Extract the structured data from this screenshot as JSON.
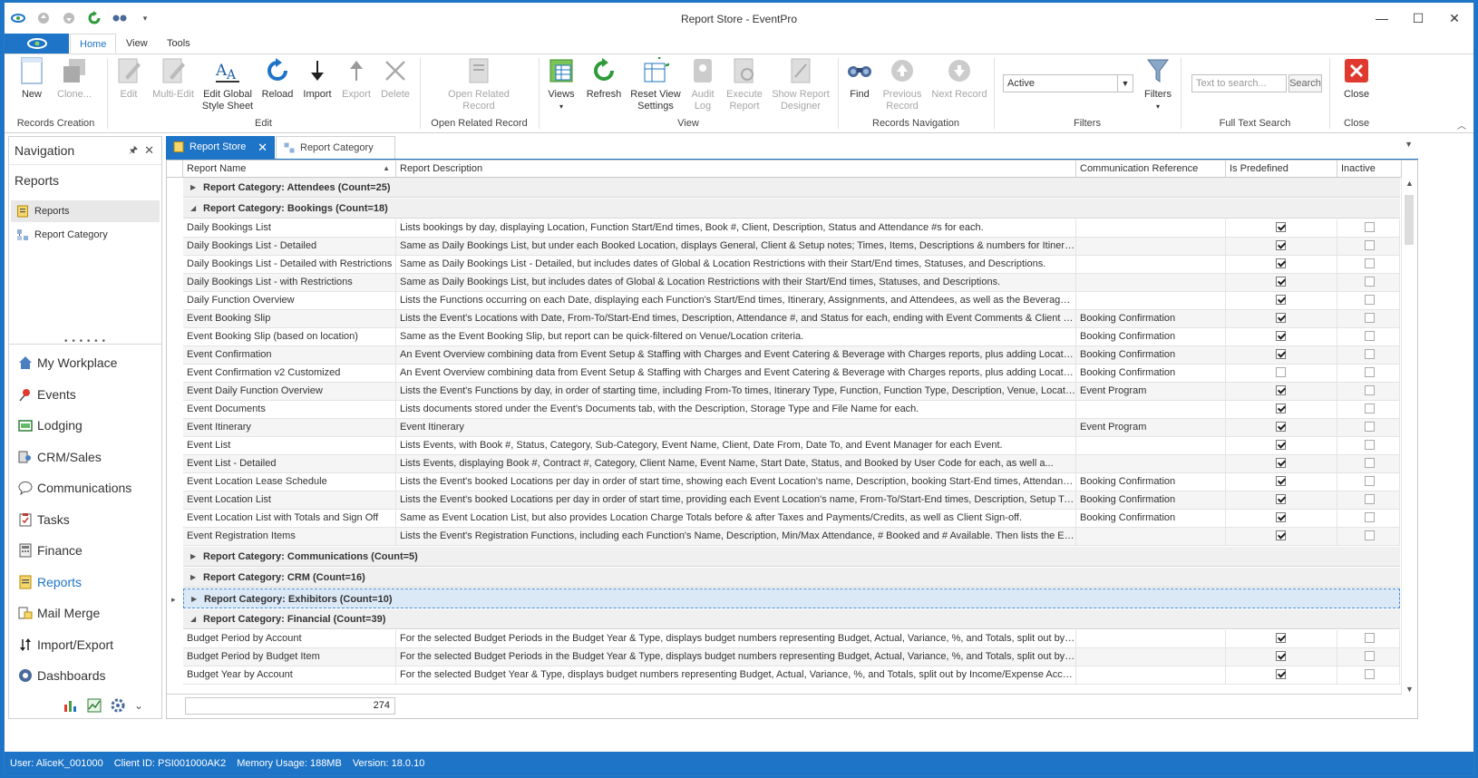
{
  "window": {
    "title": "Report Store - EventPro"
  },
  "ribbon_tabs": [
    "Home",
    "View",
    "Tools"
  ],
  "ribbon": {
    "new": "New",
    "clone": "Clone...",
    "edit": "Edit",
    "multi_edit": "Multi-Edit",
    "edit_global_1": "Edit Global",
    "edit_global_2": "Style Sheet",
    "reload": "Reload",
    "import": "Import",
    "export": "Export",
    "delete": "Delete",
    "open_related_1": "Open Related",
    "open_related_2": "Record",
    "views": "Views",
    "refresh": "Refresh",
    "reset_view_1": "Reset View",
    "reset_view_2": "Settings",
    "audit_1": "Audit",
    "audit_2": "Log",
    "execute_1": "Execute",
    "execute_2": "Report",
    "show_report_1": "Show Report",
    "show_report_2": "Designer",
    "find": "Find",
    "prev_1": "Previous",
    "prev_2": "Record",
    "next_1": "Next Record",
    "filter_value": "Active",
    "filters": "Filters",
    "search_placeholder": "Text to search...",
    "search_btn": "Search",
    "close": "Close",
    "groups": {
      "records_creation": "Records Creation",
      "edit": "Edit",
      "open_related_record": "Open Related Record",
      "view": "View",
      "records_navigation": "Records Navigation",
      "filters": "Filters",
      "full_text_search": "Full Text Search",
      "close": "Close"
    }
  },
  "nav": {
    "title": "Navigation",
    "section": "Reports",
    "items": [
      "Reports",
      "Report Category"
    ],
    "modules": [
      "My Workplace",
      "Events",
      "Lodging",
      "CRM/Sales",
      "Communications",
      "Tasks",
      "Finance",
      "Reports",
      "Mail Merge",
      "Import/Export",
      "Dashboards"
    ]
  },
  "doc_tabs": [
    "Report Store",
    "Report Category"
  ],
  "grid": {
    "columns": [
      "Report Name",
      "Report Description",
      "Communication Reference",
      "Is Predefined",
      "Inactive"
    ],
    "groups": {
      "attendees": "Report Category: Attendees (Count=25)",
      "bookings": "Report Category: Bookings (Count=18)",
      "communications": "Report Category: Communications (Count=5)",
      "crm": "Report Category: CRM (Count=16)",
      "exhibitors": "Report Category: Exhibitors (Count=10)",
      "financial": "Report Category: Financial (Count=39)"
    },
    "bookings_rows": [
      {
        "name": "Daily Bookings List",
        "desc": "Lists bookings by day, displaying Location, Function Start/End times, Book #, Client, Description, Status and Attendance #s for each.",
        "comm": "",
        "pre": true,
        "inactive": false
      },
      {
        "name": "Daily Bookings List - Detailed",
        "desc": "Same as Daily Bookings List, but under each Booked Location, displays General, Client & Setup notes; Times, Items, Descriptions & numbers for Itinerary, Cate...",
        "comm": "",
        "pre": true,
        "inactive": false
      },
      {
        "name": "Daily Bookings List - Detailed with Restrictions",
        "desc": "Same as Daily Bookings List - Detailed, but includes dates of Global & Location Restrictions with their Start/End times, Statuses, and Descriptions.",
        "comm": "",
        "pre": true,
        "inactive": false
      },
      {
        "name": "Daily Bookings List - with Restrictions",
        "desc": "Same as Daily Bookings List, but includes dates of Global & Location Restrictions with their Start/End times, Statuses, and Descriptions.",
        "comm": "",
        "pre": true,
        "inactive": false
      },
      {
        "name": "Daily Function Overview",
        "desc": "Lists the Functions occurring on each Date, displaying each Function's Start/End times, Itinerary, Assignments, and Attendees, as well as the Beverages, Cat...",
        "comm": "",
        "pre": true,
        "inactive": false
      },
      {
        "name": "Event Booking Slip",
        "desc": "Lists the Event's Locations with Date, From-To/Start-End times, Description, Attendance #, and Status for each, ending with Event Comments & Client Sign-of...",
        "comm": "Booking Confirmation",
        "pre": true,
        "inactive": false
      },
      {
        "name": "Event Booking Slip (based on location)",
        "desc": "Same as the Event Booking Slip, but report can be quick-filtered on Venue/Location criteria.",
        "comm": "Booking Confirmation",
        "pre": true,
        "inactive": false
      },
      {
        "name": "Event Confirmation",
        "desc": "An Event Overview combining data from Event Setup & Staffing with Charges and Event Catering & Beverage with Charges reports, plus adding Location Itine...",
        "comm": "Booking Confirmation",
        "pre": true,
        "inactive": false
      },
      {
        "name": "Event Confirmation v2 Customized",
        "desc": "An Event Overview combining data from Event Setup & Staffing with Charges and Event Catering & Beverage with Charges reports, plus adding Location Itine...",
        "comm": "Booking Confirmation",
        "pre": false,
        "inactive": false
      },
      {
        "name": "Event Daily Function Overview",
        "desc": "Lists the Event's Functions by day, in order of starting time, including From-To times, Itinerary Type, Function, Function Type, Description, Venue, Location, N...",
        "comm": "Event Program",
        "pre": true,
        "inactive": false
      },
      {
        "name": "Event Documents",
        "desc": "Lists documents stored under the Event's Documents tab, with the Description, Storage Type and File Name for each.",
        "comm": "",
        "pre": true,
        "inactive": false
      },
      {
        "name": "Event Itinerary",
        "desc": "Event Itinerary",
        "comm": "Event Program",
        "pre": true,
        "inactive": false
      },
      {
        "name": "Event List",
        "desc": "Lists Events, with Book #, Status, Category, Sub-Category, Event Name, Client, Date From, Date To, and Event Manager for each Event.",
        "comm": "",
        "pre": true,
        "inactive": false
      },
      {
        "name": "Event List - Detailed",
        "desc": "Lists Events, displaying Book #, Contract #, Category, Client Name, Event Name, Start Date, Status, and Booked by User Code for each, as well a...",
        "comm": "",
        "pre": true,
        "inactive": false
      },
      {
        "name": "Event Location Lease Schedule",
        "desc": "Lists the Event's booked Locations per day in order of start time, showing each Event Location's name, Description, booking Start-End times, Attendance #, a...",
        "comm": "Booking Confirmation",
        "pre": true,
        "inactive": false
      },
      {
        "name": "Event Location List",
        "desc": "Lists the Event's booked Locations per day in order of start time, providing each Event Location's name, From-To/Start-End times, Description, Setup Type, # ...",
        "comm": "Booking Confirmation",
        "pre": true,
        "inactive": false
      },
      {
        "name": "Event Location List with Totals and Sign Off",
        "desc": "Same as Event Location List, but also provides Location Charge Totals before & after Taxes and Payments/Credits, as well as Client Sign-off.",
        "comm": "Booking Confirmation",
        "pre": true,
        "inactive": false
      },
      {
        "name": "Event Registration Items",
        "desc": "Lists the Event's Registration Functions, including each Function's Name, Description, Min/Max Attendance, # Booked and # Available. Then lists the Event's R...",
        "comm": "",
        "pre": true,
        "inactive": false
      }
    ],
    "financial_rows": [
      {
        "name": "Budget Period by Account",
        "desc": "For the selected Budget Periods in the Budget Year & Type, displays budget numbers representing Budget, Actual, Variance, %, and Totals, split out by Inco...",
        "comm": "",
        "pre": true,
        "inactive": false
      },
      {
        "name": "Budget Period by Budget Item",
        "desc": "For the selected Budget Periods in the Budget Year & Type, displays budget numbers representing Budget, Actual, Variance, %, and Totals, split out by name...",
        "comm": "",
        "pre": true,
        "inactive": false
      },
      {
        "name": "Budget Year by Account",
        "desc": "For the selected Budget Year & Type, displays budget numbers representing Budget, Actual, Variance, %, and Totals, split out by Income/Expense Account C...",
        "comm": "",
        "pre": true,
        "inactive": false
      }
    ],
    "footer_count": "274"
  },
  "status": {
    "user": "User: AliceK_001000",
    "client": "Client ID: PSI001000AK2",
    "memory": "Memory Usage: 188MB",
    "version": "Version: 18.0.10"
  }
}
